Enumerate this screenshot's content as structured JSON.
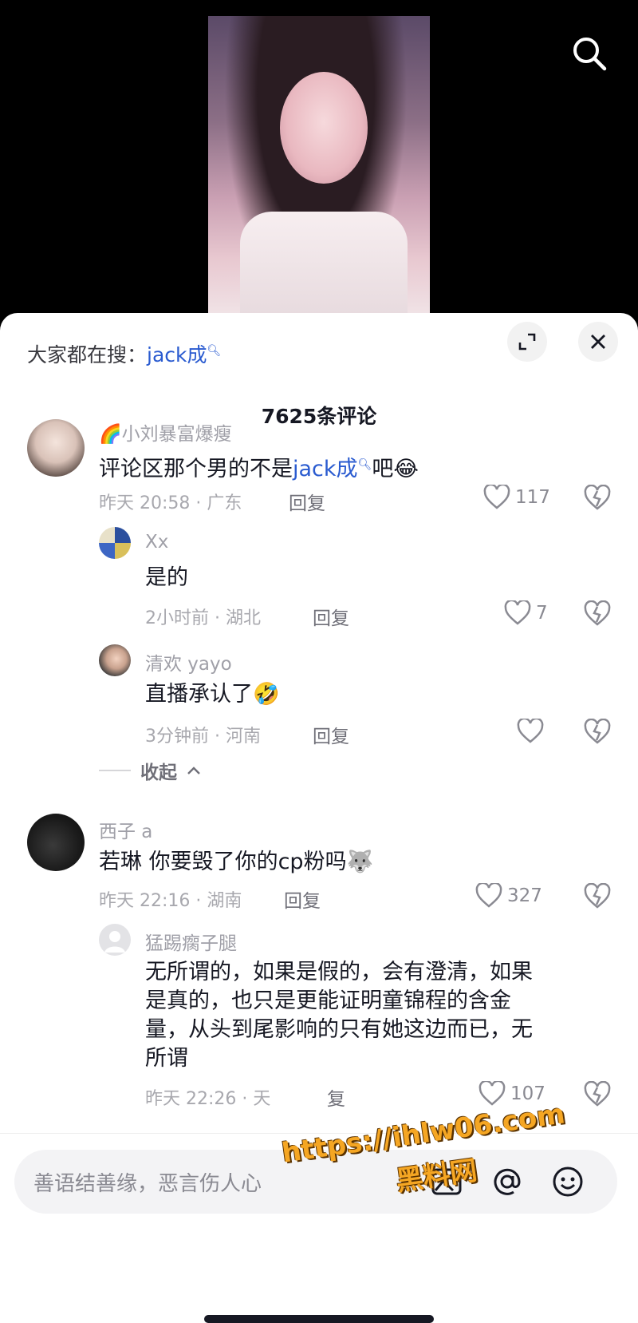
{
  "trending": {
    "prefix": "大家都在搜：",
    "keyword": "jack成"
  },
  "comment_count": "7625条评论",
  "comments": [
    {
      "user": "小刘暴富爆瘦",
      "badge": "🌈",
      "text_before": "评论区那个男的不是",
      "link": "jack成",
      "text_after": "吧",
      "emoji": "😂",
      "time": "昨天 20:58 · 广东",
      "reply": "回复",
      "likes": "117"
    },
    {
      "user": "Xx",
      "text": "是的",
      "time": "2小时前 · 湖北",
      "reply": "回复",
      "likes": "7"
    },
    {
      "user": "清欢 yayo",
      "text": "直播承认了",
      "emoji": "🤣",
      "time": "3分钟前 · 河南",
      "reply": "回复",
      "likes": ""
    },
    {
      "user": "西子 a",
      "text": "若琳 你要毁了你的cp粉吗",
      "emoji": "🐺",
      "time": "昨天 22:16 · 湖南",
      "reply": "回复",
      "likes": "327"
    },
    {
      "user": "猛踢瘸子腿",
      "text_lines": [
        "无所谓的，如果是假的，会有澄清，如果",
        "是真的，也只是更能证明童锦程的含金",
        "量，从头到尾影响的只有她这边而已，无",
        "所谓"
      ],
      "time": "昨天 22:26 · 天",
      "reply": "复",
      "likes": "107"
    }
  ],
  "collapse": "收起",
  "input_placeholder": "善语结善缘，恶言伤人心",
  "watermark": {
    "url": "https://ihlw06.com",
    "site": "黑料网"
  },
  "icons": {
    "search": "search-icon",
    "expand": "expand-icon",
    "close": "close-icon",
    "heart": "heart-icon",
    "broken_heart": "broken-heart-icon",
    "image": "image-icon",
    "at": "at-icon",
    "emoji": "emoji-icon"
  }
}
